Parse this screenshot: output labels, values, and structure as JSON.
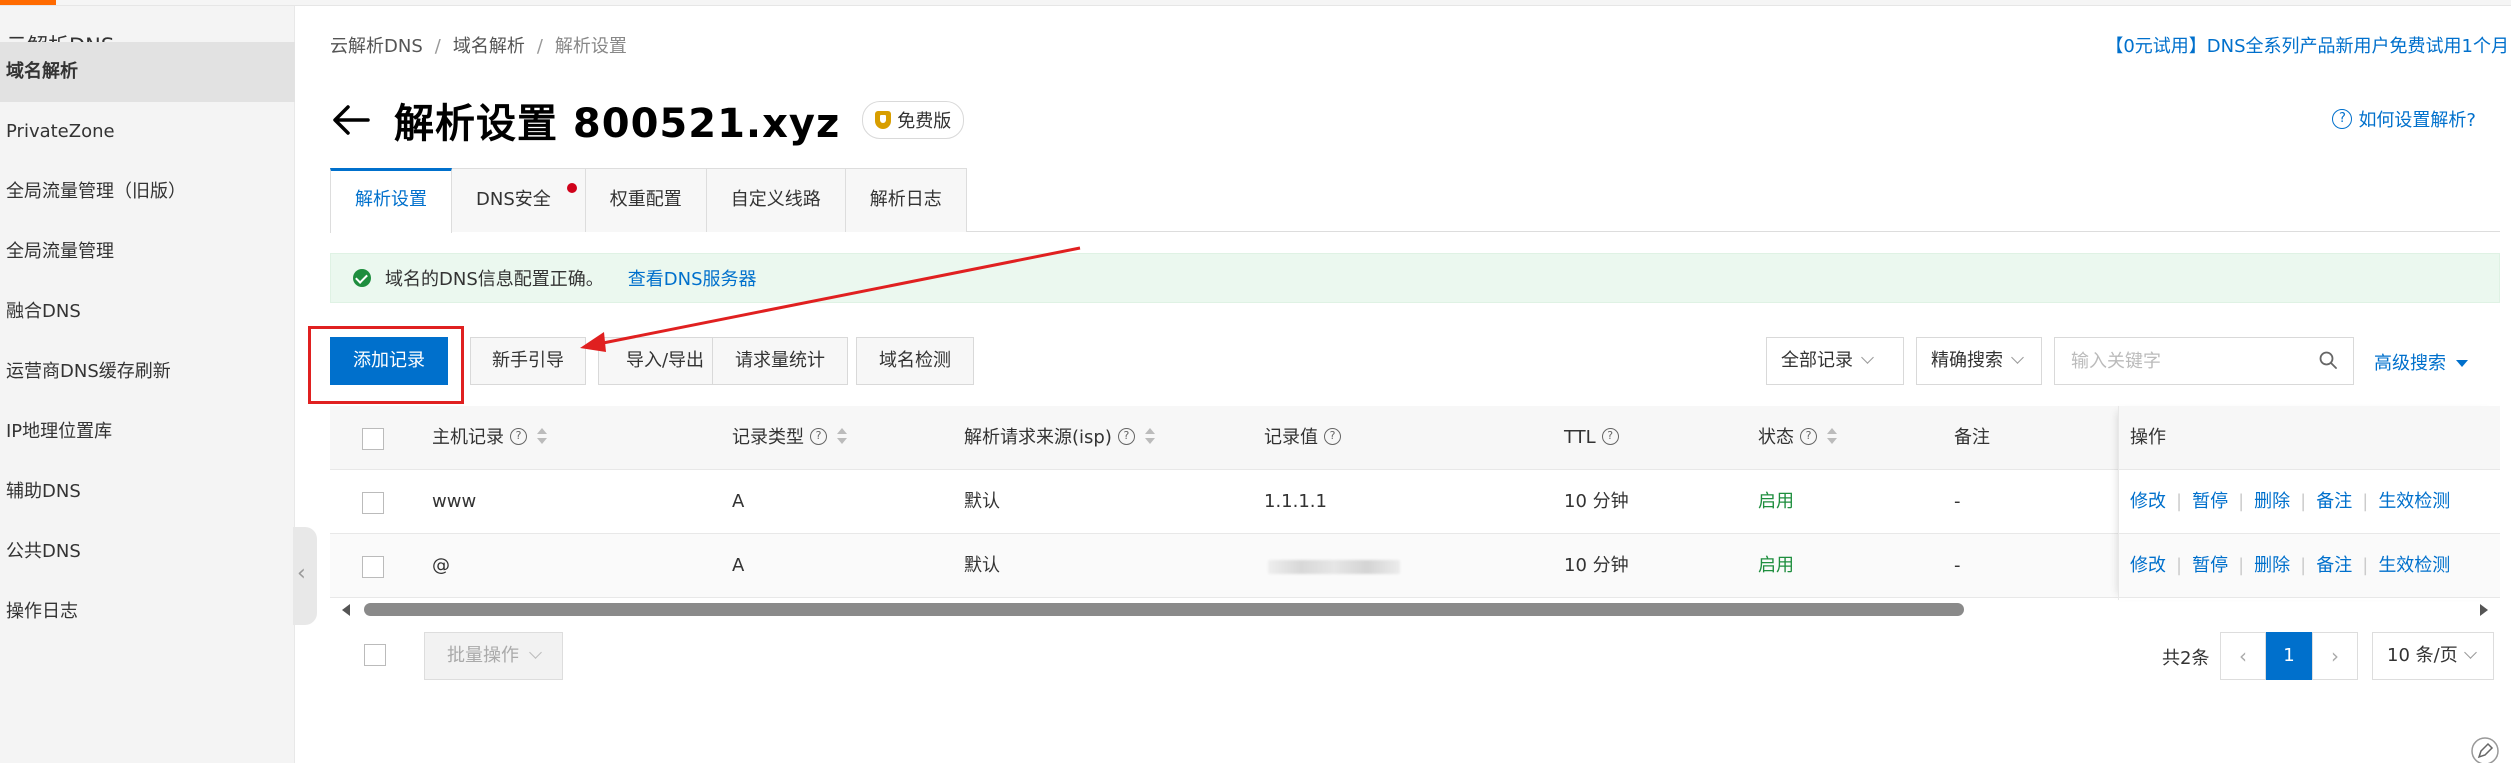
{
  "sidebar": {
    "title": "云解析DNS",
    "items": [
      {
        "label": "域名解析",
        "active": true
      },
      {
        "label": "PrivateZone"
      },
      {
        "label": "全局流量管理（旧版）"
      },
      {
        "label": "全局流量管理"
      },
      {
        "label": "融合DNS"
      },
      {
        "label": "运营商DNS缓存刷新"
      },
      {
        "label": "IP地理位置库"
      },
      {
        "label": "辅助DNS"
      },
      {
        "label": "公共DNS"
      },
      {
        "label": "操作日志"
      }
    ]
  },
  "breadcrumb": {
    "items": [
      "云解析DNS",
      "域名解析",
      "解析设置"
    ],
    "separator": "/"
  },
  "promo": "【0元试用】DNS全系列产品新用户免费试用1个月",
  "header": {
    "title": "解析设置 800521.xyz",
    "badge": "免费版",
    "help": "如何设置解析?"
  },
  "tabs": [
    {
      "label": "解析设置",
      "active": true
    },
    {
      "label": "DNS安全",
      "dot": true
    },
    {
      "label": "权重配置"
    },
    {
      "label": "自定义线路"
    },
    {
      "label": "解析日志"
    }
  ],
  "alert": {
    "message": "域名的DNS信息配置正确。",
    "link": "查看DNS服务器"
  },
  "toolbar": {
    "add": "添加记录",
    "guide": "新手引导",
    "import_export": "导入/导出",
    "stats": "请求量统计",
    "check": "域名检测",
    "filter": "全部记录",
    "search_mode": "精确搜索",
    "search_placeholder": "输入关键字",
    "advanced": "高级搜索"
  },
  "table": {
    "columns": {
      "host": "主机记录",
      "type": "记录类型",
      "isp": "解析请求来源(isp)",
      "value": "记录值",
      "ttl": "TTL",
      "status": "状态",
      "remark": "备注",
      "ops": "操作"
    },
    "rows": [
      {
        "host": "www",
        "type": "A",
        "isp": "默认",
        "value": "1.1.1.1",
        "ttl": "10 分钟",
        "status": "启用",
        "remark": "-"
      },
      {
        "host": "@",
        "type": "A",
        "isp": "默认",
        "value": "",
        "ttl": "10 分钟",
        "status": "启用",
        "remark": "-"
      }
    ],
    "ops": [
      "修改",
      "暂停",
      "删除",
      "备注",
      "生效检测"
    ]
  },
  "footer": {
    "batch": "批量操作",
    "total": "共2条",
    "current_page": "1",
    "page_size": "10 条/页"
  },
  "colors": {
    "primary": "#0070cc",
    "success": "#1e8e3e",
    "annotation": "#e02020",
    "brand": "#ff6a00"
  }
}
